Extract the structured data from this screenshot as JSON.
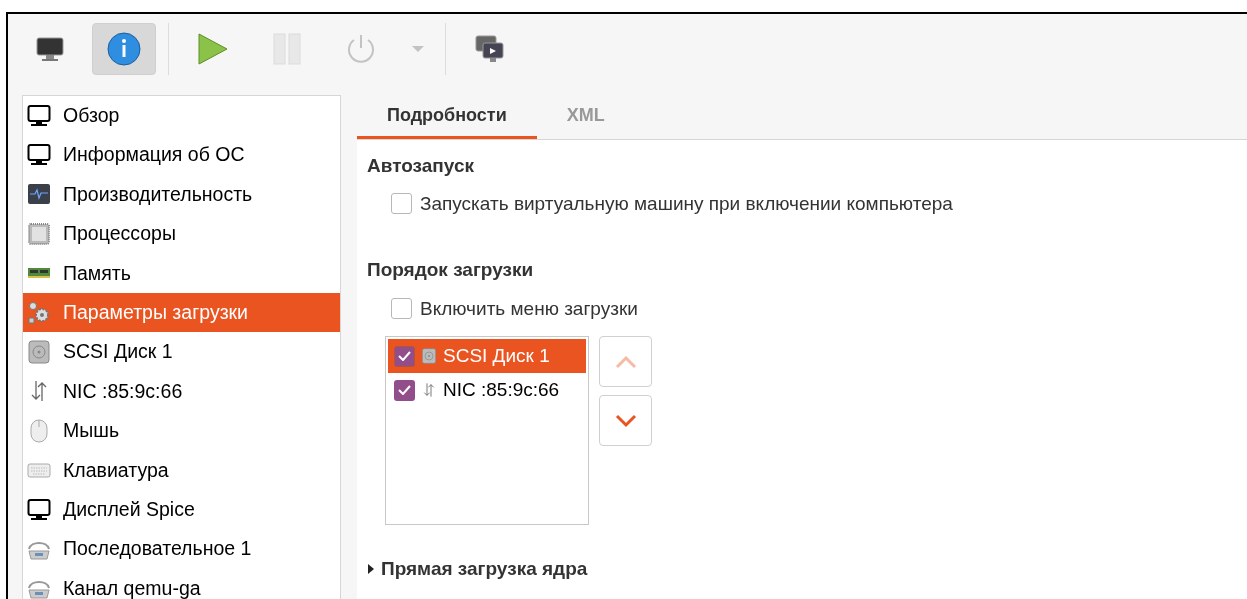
{
  "toolbar": [
    {
      "kind": "monitor",
      "selected": false,
      "disabled": false
    },
    {
      "kind": "info",
      "selected": true,
      "disabled": false
    },
    {
      "kind": "separator"
    },
    {
      "kind": "play",
      "selected": false,
      "disabled": false
    },
    {
      "kind": "pause",
      "selected": false,
      "disabled": true
    },
    {
      "kind": "power",
      "selected": false,
      "disabled": true
    },
    {
      "kind": "dropdown",
      "selected": false,
      "disabled": true
    },
    {
      "kind": "separator"
    },
    {
      "kind": "screens",
      "selected": false,
      "disabled": false
    }
  ],
  "sidebar": {
    "items": [
      {
        "label": "Обзор",
        "kind": "monitor",
        "selected": false
      },
      {
        "label": "Информация об ОС",
        "kind": "monitor",
        "selected": false
      },
      {
        "label": "Производительность",
        "kind": "perf",
        "selected": false
      },
      {
        "label": "Процессоры",
        "kind": "cpu",
        "selected": false
      },
      {
        "label": "Память",
        "kind": "memory",
        "selected": false
      },
      {
        "label": "Параметры загрузки",
        "kind": "gears",
        "selected": true
      },
      {
        "label": "SCSI Диск 1",
        "kind": "disk",
        "selected": false
      },
      {
        "label": "NIC :85:9c:66",
        "kind": "nic",
        "selected": false
      },
      {
        "label": "Мышь",
        "kind": "mouse",
        "selected": false
      },
      {
        "label": "Клавиатура",
        "kind": "keyboard",
        "selected": false
      },
      {
        "label": "Дисплей Spice",
        "kind": "monitor",
        "selected": false
      },
      {
        "label": "Последовательное 1",
        "kind": "serial",
        "selected": false
      },
      {
        "label": "Канал qemu-ga",
        "kind": "serial",
        "selected": false
      }
    ]
  },
  "tabs": [
    {
      "label": "Подробности",
      "selected": true
    },
    {
      "label": "XML",
      "selected": false
    }
  ],
  "autostart": {
    "title": "Автозапуск",
    "checkbox": {
      "label": "Запускать виртуальную машину при включении компьютера",
      "checked": false
    }
  },
  "boot_order": {
    "title": "Порядок загрузки",
    "menu_checkbox": {
      "label": "Включить меню загрузки",
      "checked": false
    },
    "devices": [
      {
        "label": "SCSI Диск 1",
        "kind": "disk",
        "checked": true,
        "selected": true
      },
      {
        "label": "NIC :85:9c:66",
        "kind": "nic",
        "checked": true,
        "selected": false
      }
    ],
    "move_up": {
      "disabled": true
    },
    "move_down": {
      "disabled": false
    }
  },
  "kernel_boot": {
    "title": "Прямая загрузка ядра",
    "expanded": false
  }
}
